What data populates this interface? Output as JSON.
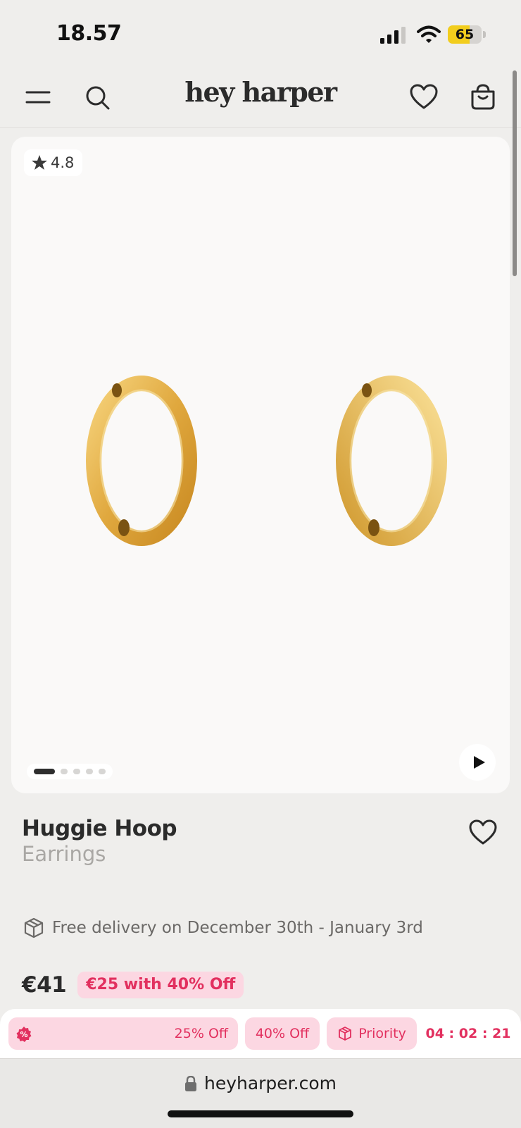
{
  "status_bar": {
    "time": "18.57",
    "battery_level": "65",
    "battery_fraction": 0.65,
    "battery_color": "#f2cd1d",
    "signal_icon": "signal-icon",
    "wifi_icon": "wifi-icon"
  },
  "nav": {
    "brand": "hey harper",
    "icons": [
      "menu-icon",
      "search-icon",
      "heart-icon",
      "shopping-bag-icon"
    ]
  },
  "gallery": {
    "rating": "4.8",
    "rating_icon": "star-icon",
    "image_count": 5,
    "active_image": 1,
    "play_icon": "play-icon"
  },
  "product": {
    "title": "Huggie Hoop",
    "subtitle": "Earrings",
    "delivery_text": "Free delivery on December 30th - January 3rd",
    "price": "€41",
    "discount_price": "€25 with 40% Off"
  },
  "promo_bar": {
    "pill_1_label": "25% Off",
    "pill_2_label": "40% Off",
    "pill_3_label": "Priority",
    "countdown": "04 : 02 : 21",
    "accent_color": "#e2305f",
    "pill_color": "#fcd7e2"
  },
  "browser": {
    "url": "heyharper.com",
    "lock_icon": "lock-icon"
  }
}
